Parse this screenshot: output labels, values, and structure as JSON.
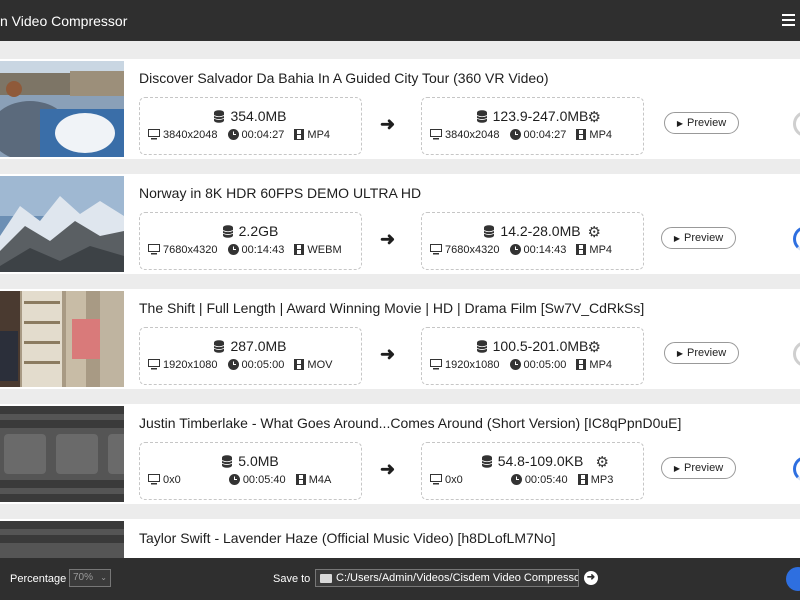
{
  "app": {
    "title": "n Video Compressor"
  },
  "videos": [
    {
      "title": "Discover Salvador Da Bahia In A Guided City Tour (360 VR Video)",
      "source": {
        "size": "354.0MB",
        "resolution": "3840x2048",
        "duration": "00:04:27",
        "format": "MP4"
      },
      "output": {
        "size": "123.9-247.0MB",
        "resolution": "3840x2048",
        "duration": "00:04:27",
        "format": "MP4"
      },
      "preview": "Preview"
    },
    {
      "title": "Norway in 8K HDR 60FPS DEMO ULTRA HD",
      "source": {
        "size": "2.2GB",
        "resolution": "7680x4320",
        "duration": "00:14:43",
        "format": "WEBM"
      },
      "output": {
        "size": "14.2-28.0MB",
        "resolution": "7680x4320",
        "duration": "00:14:43",
        "format": "MP4"
      },
      "preview": "Preview"
    },
    {
      "title": "The Shift | Full Length | Award Winning Movie | HD | Drama Film [Sw7V_CdRkSs]",
      "source": {
        "size": "287.0MB",
        "resolution": "1920x1080",
        "duration": "00:05:00",
        "format": "MOV"
      },
      "output": {
        "size": "100.5-201.0MB",
        "resolution": "1920x1080",
        "duration": "00:05:00",
        "format": "MP4"
      },
      "preview": "Preview"
    },
    {
      "title": "Justin Timberlake - What Goes Around...Comes Around (Short Version) [IC8qPpnD0uE]",
      "source": {
        "size": "5.0MB",
        "resolution": "0x0",
        "duration": "00:05:40",
        "format": "M4A"
      },
      "output": {
        "size": "54.8-109.0KB",
        "resolution": "0x0",
        "duration": "00:05:40",
        "format": "MP3"
      },
      "preview": "Preview"
    },
    {
      "title": "Taylor Swift - Lavender Haze (Official Music Video) [h8DLofLM7No]"
    }
  ],
  "bottom": {
    "percentage_label": "Percentage",
    "percentage_value": "70%",
    "save_to_label": "Save to",
    "save_path": "C:/Users/Admin/Videos/Cisdem Video Compressor"
  },
  "colors": {
    "accent": "#2e6fe0",
    "bar": "#2f2f2f",
    "row": "#ffffff",
    "background": "#ececec"
  },
  "icons": [
    "menu-icon",
    "database-icon",
    "monitor-icon",
    "clock-icon",
    "film-icon",
    "gear-icon",
    "arrow-right-icon",
    "play-icon",
    "folder-icon",
    "go-arrow-icon",
    "progress-ring-icon"
  ]
}
